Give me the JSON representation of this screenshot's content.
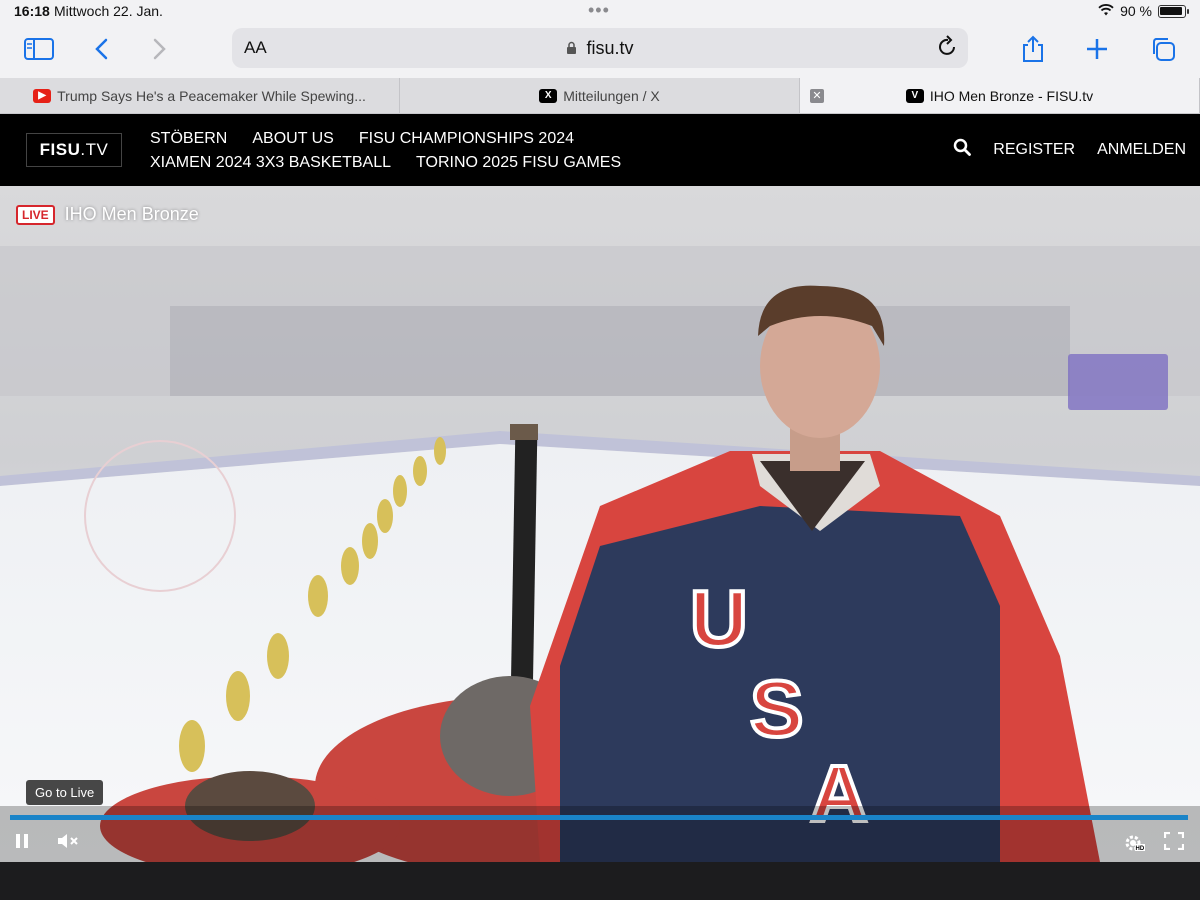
{
  "status": {
    "time": "16:18",
    "date": "Mittwoch 22. Jan.",
    "battery": "90 %"
  },
  "toolbar": {
    "text_size": "AA",
    "url": "fisu.tv"
  },
  "tabs": [
    {
      "title": "Trump Says He's a Peacemaker While Spewing...",
      "favicon": "youtube-icon"
    },
    {
      "title": "Mitteilungen / X",
      "favicon": "x-icon"
    },
    {
      "title": "IHO Men Bronze - FISU.tv",
      "favicon": "fisu-icon"
    }
  ],
  "site": {
    "logo_bold": "FISU",
    "logo_light": ".TV",
    "nav": [
      "STÖBERN",
      "ABOUT US",
      "FISU CHAMPIONSHIPS 2024",
      "XIAMEN 2024 3X3 BASKETBALL",
      "TORINO 2025 FISU GAMES"
    ],
    "register": "REGISTER",
    "login": "ANMELDEN"
  },
  "player": {
    "live_badge": "LIVE",
    "title": "IHO Men Bronze",
    "go_to_live": "Go to Live",
    "progress": 1.0
  },
  "colors": {
    "accent": "#1a73e8",
    "live_red": "#d6262c",
    "progress_blue": "#1a84c8",
    "jersey_navy": "#2d3a5c",
    "jersey_red": "#d8453f"
  }
}
